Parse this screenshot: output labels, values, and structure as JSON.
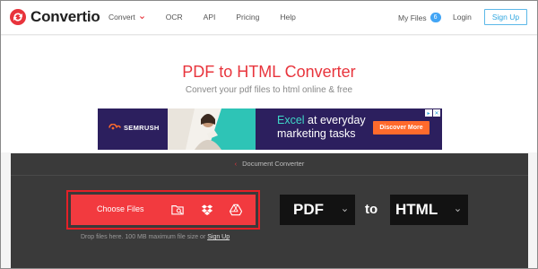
{
  "app": {
    "name": "Convertio"
  },
  "nav": {
    "items": [
      "Convert",
      "OCR",
      "API",
      "Pricing",
      "Help"
    ],
    "my_files_label": "My Files",
    "my_files_count": "6",
    "login_label": "Login",
    "signup_label": "Sign Up"
  },
  "hero": {
    "title": "PDF to HTML Converter",
    "subtitle": "Convert your pdf files to html online & free"
  },
  "ad": {
    "brand": "SEMRUSH",
    "headline_highlight": "Excel",
    "headline_rest": " at everyday",
    "headline_line2": "marketing tasks",
    "cta": "Discover More"
  },
  "converter": {
    "breadcrumb": "Document Converter",
    "choose_files_label": "Choose Files",
    "drop_hint": "Drop files here. 100 MB maximum file size or ",
    "drop_hint_link": "Sign Up",
    "from_format": "PDF",
    "to_label": "to",
    "to_format": "HTML"
  },
  "colors": {
    "brand_red": "#e8343c",
    "accent_blue": "#2ea6e0",
    "dark_band": "#3a3a3a",
    "ad_bg": "#2c1f5e",
    "ad_cta": "#ff6a2c"
  },
  "icons": [
    "convertio-logo-icon",
    "chevron-down-icon",
    "folder-search-icon",
    "dropbox-icon",
    "google-drive-icon",
    "semrush-logo-icon",
    "adchoices-icon",
    "arrow-left-icon"
  ]
}
